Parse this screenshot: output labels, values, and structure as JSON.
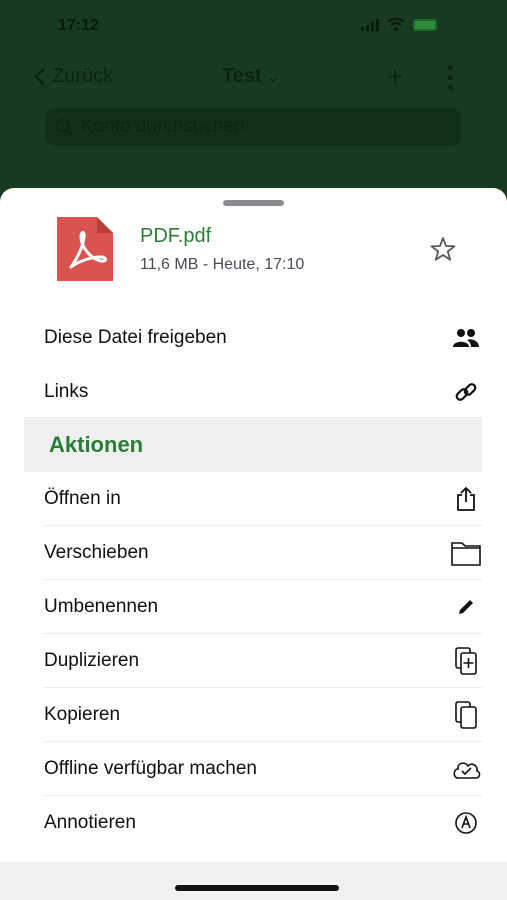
{
  "status_bar": {
    "time": "17:12",
    "icons": [
      "location-arrow-icon",
      "signal-icon",
      "wifi-icon",
      "battery-charging-icon"
    ]
  },
  "background_nav": {
    "back_label": "Zurück",
    "title": "Test",
    "search_placeholder": "Konto durchsuchen"
  },
  "sheet": {
    "file": {
      "name": "PDF.pdf",
      "meta": "11,6 MB - Heute, 17:10",
      "icon": "pdf-file-icon"
    },
    "share_items": [
      {
        "label": "Diese Datei freigeben",
        "icon": "people-icon"
      },
      {
        "label": "Links",
        "icon": "link-icon"
      }
    ],
    "section_title": "Aktionen",
    "action_items": [
      {
        "label": "Öffnen in",
        "icon": "share-up-icon"
      },
      {
        "label": "Verschieben",
        "icon": "folder-icon"
      },
      {
        "label": "Umbenennen",
        "icon": "pencil-icon"
      },
      {
        "label": "Duplizieren",
        "icon": "duplicate-icon"
      },
      {
        "label": "Kopieren",
        "icon": "copy-icon"
      },
      {
        "label": "Offline verfügbar machen",
        "icon": "cloud-check-icon"
      },
      {
        "label": "Annotieren",
        "icon": "annotate-icon"
      }
    ]
  },
  "colors": {
    "accent_green": "#2a7d34",
    "pdf_red": "#d9534f",
    "overlay_dark": "#183a20"
  }
}
